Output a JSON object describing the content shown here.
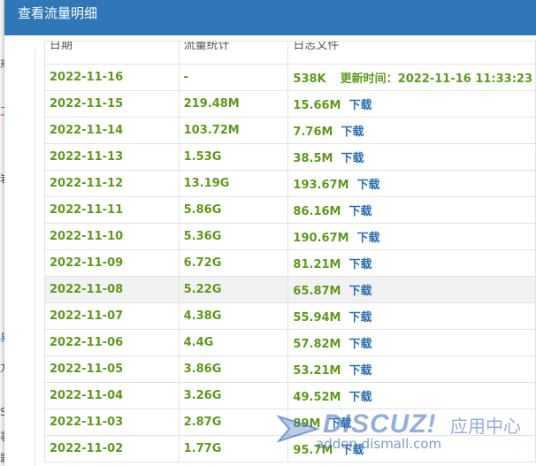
{
  "dialog": {
    "title": "查看流量明细"
  },
  "table": {
    "headers": [
      "日期",
      "流量统计",
      "日志文件"
    ],
    "rows": [
      {
        "date": "2022-11-16",
        "traffic": "-",
        "log_size": "538K",
        "update_label": "更新时间：",
        "update_time": "2022-11-16 11:33:23"
      },
      {
        "date": "2022-11-15",
        "traffic": "219.48M",
        "log_size": "15.66M",
        "link": "下载"
      },
      {
        "date": "2022-11-14",
        "traffic": "103.72M",
        "log_size": "7.76M",
        "link": "下载"
      },
      {
        "date": "2022-11-13",
        "traffic": "1.53G",
        "log_size": "38.5M",
        "link": "下载"
      },
      {
        "date": "2022-11-12",
        "traffic": "13.19G",
        "log_size": "193.67M",
        "link": "下载"
      },
      {
        "date": "2022-11-11",
        "traffic": "5.86G",
        "log_size": "86.16M",
        "link": "下载"
      },
      {
        "date": "2022-11-10",
        "traffic": "5.36G",
        "log_size": "190.67M",
        "link": "下载"
      },
      {
        "date": "2022-11-09",
        "traffic": "6.72G",
        "log_size": "81.21M",
        "link": "下载"
      },
      {
        "date": "2022-11-08",
        "traffic": "5.22G",
        "log_size": "65.87M",
        "link": "下载"
      },
      {
        "date": "2022-11-07",
        "traffic": "4.38G",
        "log_size": "55.94M",
        "link": "下载"
      },
      {
        "date": "2022-11-06",
        "traffic": "4.4G",
        "log_size": "57.82M",
        "link": "下载"
      },
      {
        "date": "2022-11-05",
        "traffic": "3.86G",
        "log_size": "53.21M",
        "link": "下载"
      },
      {
        "date": "2022-11-04",
        "traffic": "3.26G",
        "log_size": "49.52M",
        "link": "下载"
      },
      {
        "date": "2022-11-03",
        "traffic": "2.87G",
        "log_size": "89M",
        "link": "下载"
      },
      {
        "date": "2022-11-02",
        "traffic": "1.77G",
        "log_size": "95.7M",
        "link": "下载"
      }
    ]
  },
  "watermark": {
    "brand": "DISCUZ!",
    "brand_cn": "应用中心",
    "url": "addon.dismall.com"
  },
  "background": {
    "glyphs": [
      "戒",
      "工",
      "岩",
      "易",
      "方",
      "S",
      "署",
      "题"
    ]
  }
}
